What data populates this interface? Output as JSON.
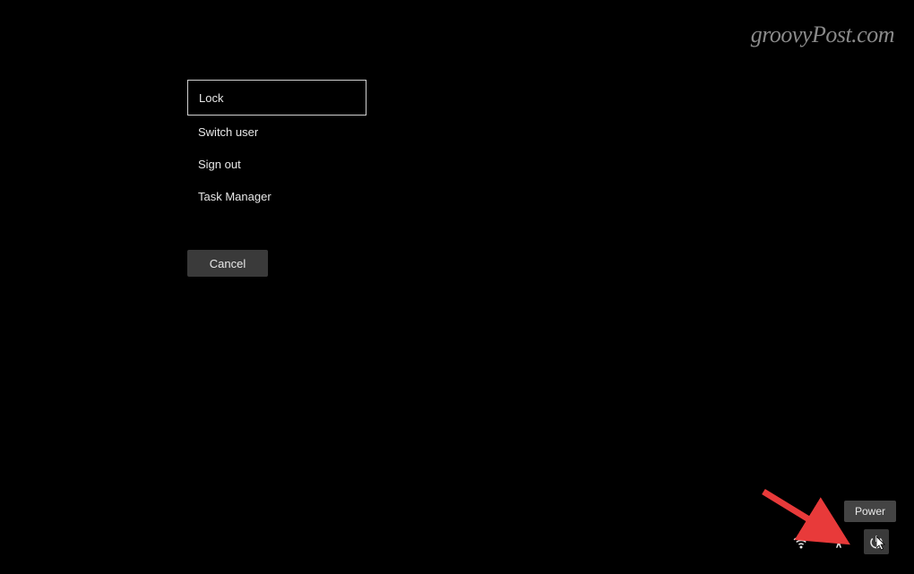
{
  "watermark": "groovyPost.com",
  "menu": {
    "items": [
      {
        "label": "Lock",
        "selected": true
      },
      {
        "label": "Switch user",
        "selected": false
      },
      {
        "label": "Sign out",
        "selected": false
      },
      {
        "label": "Task Manager",
        "selected": false
      }
    ],
    "cancel_label": "Cancel"
  },
  "actionbar": {
    "tooltip": "Power",
    "icons": {
      "wifi": "wifi-icon",
      "accessibility": "accessibility-icon",
      "power": "power-icon"
    }
  },
  "annotation": {
    "arrow_color": "#e83a3a"
  }
}
